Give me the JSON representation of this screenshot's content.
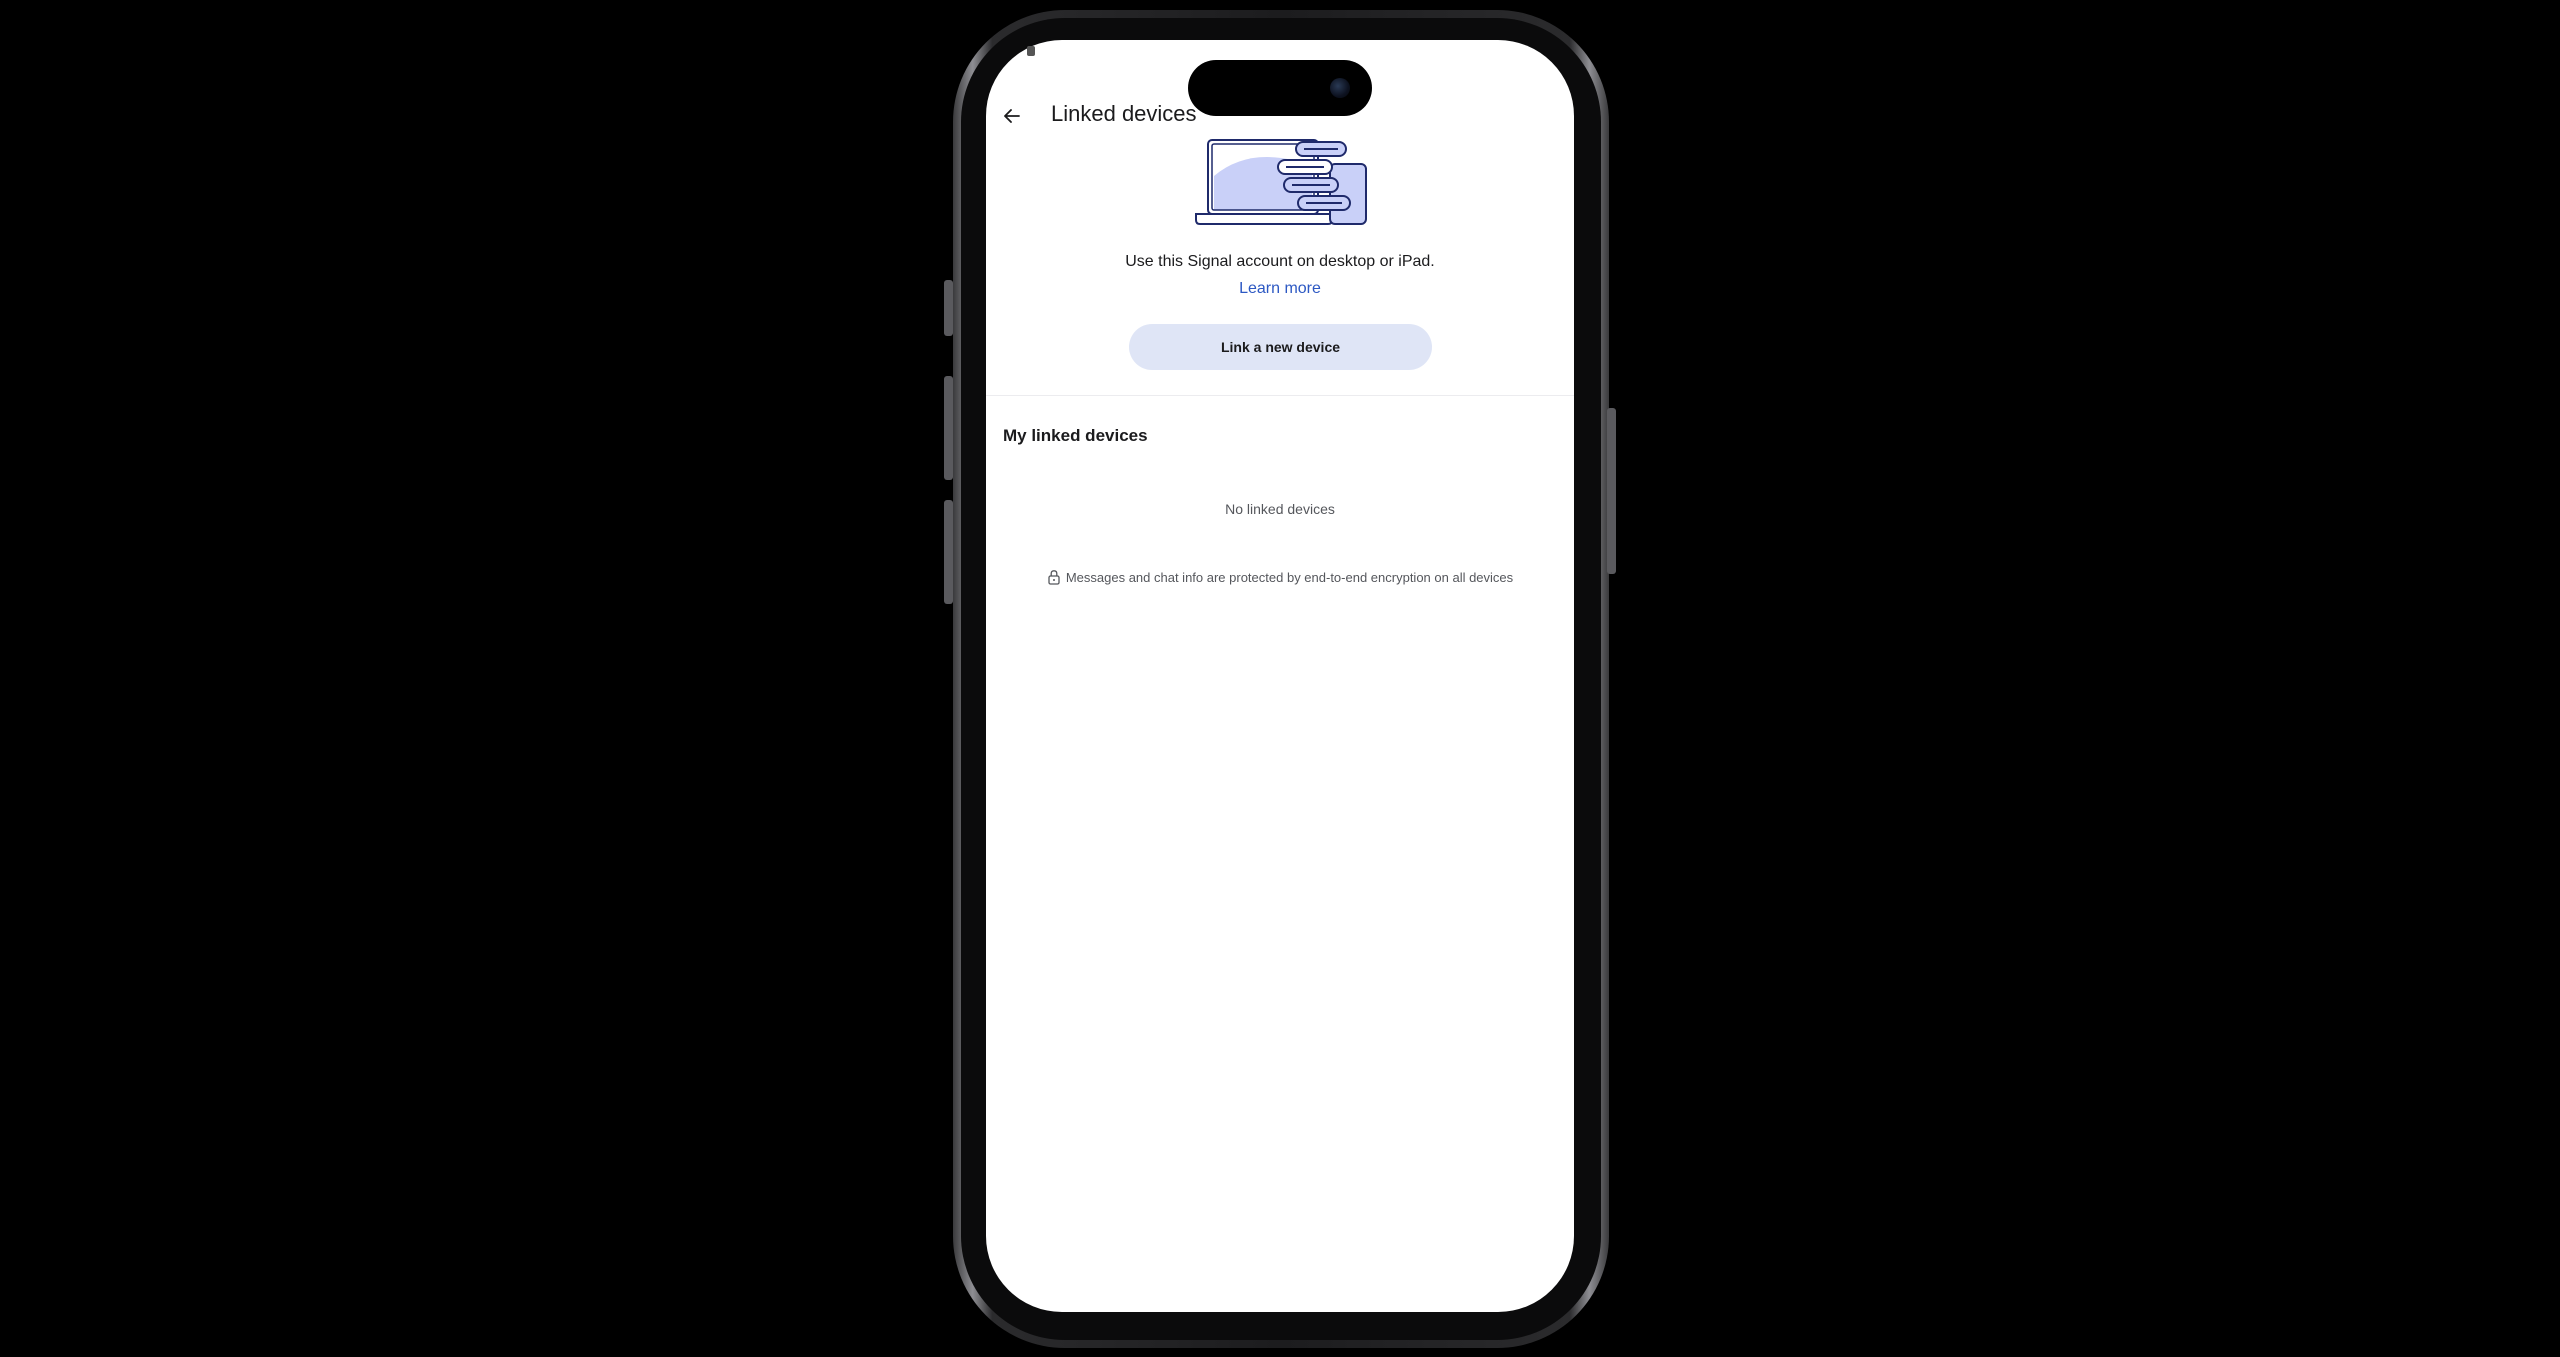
{
  "app": {
    "title": "Linked devices"
  },
  "hero": {
    "description": "Use this Signal account on desktop or iPad.",
    "learn_more_label": "Learn more",
    "link_button_label": "Link a new device",
    "illustration_icon": "devices-illustration-icon"
  },
  "linked_devices": {
    "section_title": "My linked devices",
    "empty_text": "No linked devices"
  },
  "footer_note": {
    "icon": "lock-icon",
    "text": "Messages and chat info are protected by end-to-end encryption on all devices"
  },
  "colors": {
    "accent": "#2c58c3",
    "button_bg": "#dfe5f6",
    "illustration_fill": "#c9d0f8",
    "illustration_stroke": "#1f2a6b"
  }
}
